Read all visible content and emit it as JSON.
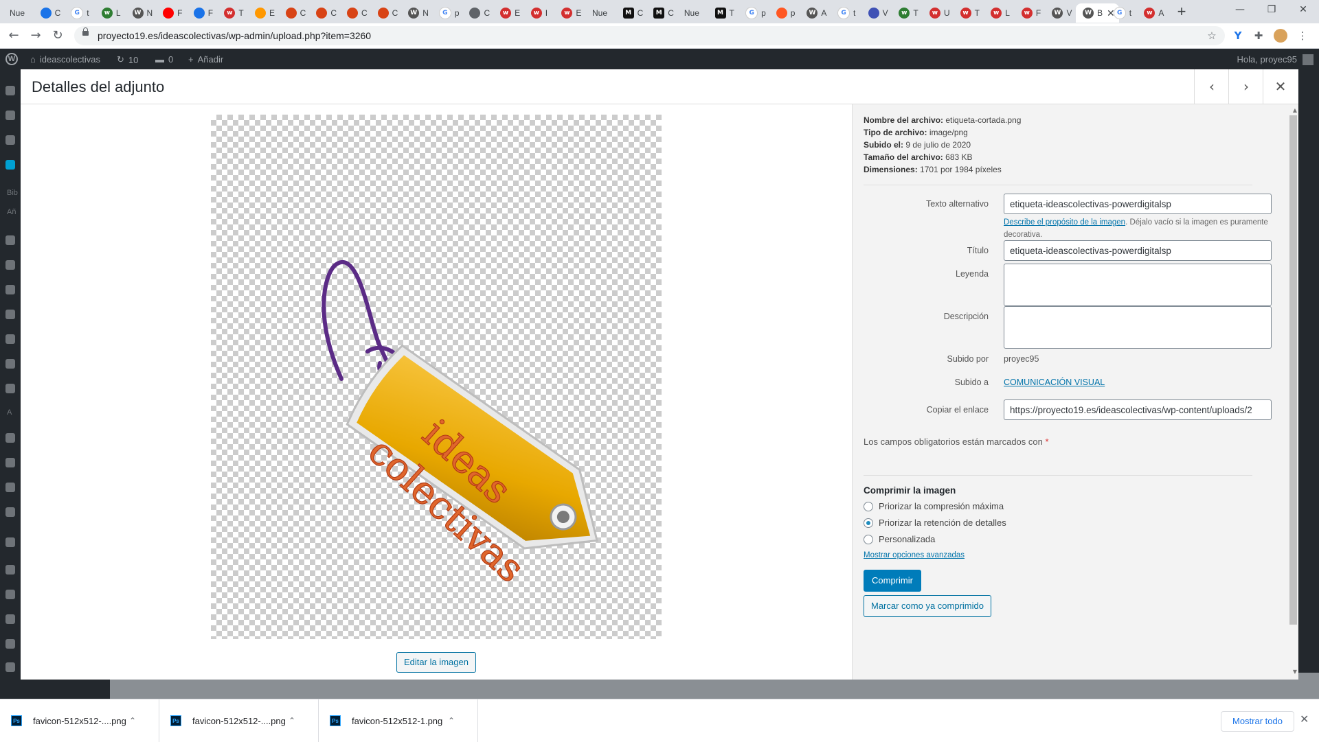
{
  "browser": {
    "tabs": [
      {
        "label": "Nue",
        "icon": "new-tab-icon",
        "color": "#dee1e6"
      },
      {
        "label": "C",
        "icon": "yoast-icon",
        "color": "#1a73e8"
      },
      {
        "label": "t",
        "icon": "google-icon",
        "color": "#ffffff"
      },
      {
        "label": "L",
        "icon": "site-icon",
        "color": "#2e7d32"
      },
      {
        "label": "N",
        "icon": "wordpress-icon",
        "color": "#555555"
      },
      {
        "label": "F",
        "icon": "youtube-icon",
        "color": "#ff0000"
      },
      {
        "label": "F",
        "icon": "settings-icon",
        "color": "#1a73e8"
      },
      {
        "label": "T",
        "icon": "site-red-icon",
        "color": "#d32f2f"
      },
      {
        "label": "E",
        "icon": "emoji-icon",
        "color": "#ff9800"
      },
      {
        "label": "C",
        "icon": "cookie-icon",
        "color": "#d84315"
      },
      {
        "label": "C",
        "icon": "cookie-icon",
        "color": "#d84315"
      },
      {
        "label": "C",
        "icon": "cookie-icon",
        "color": "#d84315"
      },
      {
        "label": "C",
        "icon": "cookie-icon",
        "color": "#d84315"
      },
      {
        "label": "N",
        "icon": "wordpress-icon",
        "color": "#555555"
      },
      {
        "label": "p",
        "icon": "google-icon",
        "color": "#ffffff"
      },
      {
        "label": "C",
        "icon": "chat-icon",
        "color": "#5f6368"
      },
      {
        "label": "E",
        "icon": "w-icon",
        "color": "#d32f2f"
      },
      {
        "label": "I",
        "icon": "site-red-icon",
        "color": "#d32f2f"
      },
      {
        "label": "E",
        "icon": "site-red-icon",
        "color": "#d32f2f"
      },
      {
        "label": "Nue",
        "icon": "new-tab-icon",
        "color": "#dee1e6"
      },
      {
        "label": "C",
        "icon": "medium-icon",
        "color": "#111111"
      },
      {
        "label": "C",
        "icon": "medium-icon",
        "color": "#111111"
      },
      {
        "label": "Nue",
        "icon": "new-tab-icon",
        "color": "#dee1e6"
      },
      {
        "label": "T",
        "icon": "medium-icon",
        "color": "#111111"
      },
      {
        "label": "p",
        "icon": "google-icon",
        "color": "#ffffff"
      },
      {
        "label": "p",
        "icon": "link-icon",
        "color": "#ff5722"
      },
      {
        "label": "A",
        "icon": "wordpress-icon",
        "color": "#555555"
      },
      {
        "label": "t",
        "icon": "google-icon",
        "color": "#ffffff"
      },
      {
        "label": "V",
        "icon": "shield-icon",
        "color": "#3f51b5"
      },
      {
        "label": "T",
        "icon": "site-green-icon",
        "color": "#2e7d32"
      },
      {
        "label": "U",
        "icon": "site-red-icon",
        "color": "#d32f2f"
      },
      {
        "label": "T",
        "icon": "w-icon",
        "color": "#d32f2f"
      },
      {
        "label": "L",
        "icon": "site-red-icon",
        "color": "#d32f2f"
      },
      {
        "label": "F",
        "icon": "site-red-icon",
        "color": "#d32f2f"
      },
      {
        "label": "V",
        "icon": "wordpress-icon",
        "color": "#555555"
      },
      {
        "label": "B",
        "icon": "wordpress-icon",
        "color": "#555555",
        "active": true
      },
      {
        "label": "t",
        "icon": "google-icon",
        "color": "#ffffff"
      },
      {
        "label": "A",
        "icon": "w-icon",
        "color": "#d32f2f"
      }
    ],
    "url": "proyecto19.es/ideascolectivas/wp-admin/upload.php?item=3260"
  },
  "adminbar": {
    "site_name": "ideascolectivas",
    "updates_count": "10",
    "comments_count": "0",
    "add_new": "Añadir",
    "greeting": "Hola, proyec95"
  },
  "sidebar_peek": {
    "item1": "Bib",
    "item2": "Añ",
    "item3": "A"
  },
  "modal": {
    "title": "Detalles del adjunto",
    "edit_image_label": "Editar la imagen",
    "image_alt": "ideas colectivas"
  },
  "file_info": {
    "name_label": "Nombre del archivo:",
    "name": "etiqueta-cortada.png",
    "type_label": "Tipo de archivo:",
    "type": "image/png",
    "uploaded_label": "Subido el:",
    "uploaded": "9 de julio de 2020",
    "size_label": "Tamaño del archivo:",
    "size": "683 KB",
    "dimensions_label": "Dimensiones:",
    "dimensions": "1701 por 1984 píxeles"
  },
  "fields": {
    "alt_label": "Texto alternativo",
    "alt_value": "etiqueta-ideascolectivas-powerdigitalsp",
    "alt_help_link": "Describe el propósito de la imagen",
    "alt_help_text": ". Déjalo vacío si la imagen es puramente decorativa.",
    "title_label": "Título",
    "title_value": "etiqueta-ideascolectivas-powerdigitalsp",
    "caption_label": "Leyenda",
    "caption_value": "",
    "description_label": "Descripción",
    "description_value": "",
    "uploaded_by_label": "Subido por",
    "uploaded_by": "proyec95",
    "uploaded_to_label": "Subido a",
    "uploaded_to": "COMUNICACIÓN VISUAL",
    "copy_link_label": "Copiar el enlace",
    "copy_link_value": "https://proyecto19.es/ideascolectivas/wp-content/uploads/2"
  },
  "required_note": "Los campos obligatorios están marcados con",
  "required_mark": "*",
  "compress": {
    "title": "Comprimir la imagen",
    "options": [
      {
        "label": "Priorizar la compresión máxima",
        "checked": false
      },
      {
        "label": "Priorizar la retención de detalles",
        "checked": true
      },
      {
        "label": "Personalizada",
        "checked": false
      }
    ],
    "advanced_link": "Mostrar opciones avanzadas",
    "compress_button": "Comprimir",
    "mark_button": "Marcar como ya comprimido"
  },
  "downloads": {
    "items": [
      {
        "name": "favicon-512x512-....png"
      },
      {
        "name": "favicon-512x512-....png"
      },
      {
        "name": "favicon-512x512-1.png"
      }
    ],
    "show_all": "Mostrar todo"
  },
  "colors": {
    "wp_blue": "#007cba",
    "link": "#0073aa",
    "tag_gold": "#e8a800",
    "tag_text": "#e0662c",
    "string_purple": "#5b2b86"
  }
}
